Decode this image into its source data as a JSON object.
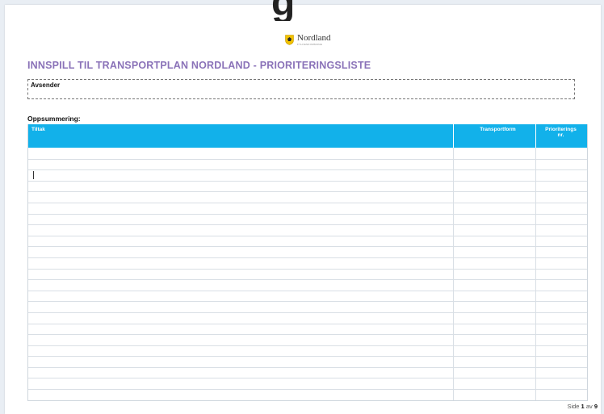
{
  "logo": {
    "name": "Nordland",
    "subtitle": "FYLKESKOMMUNE",
    "top_glyph": "g"
  },
  "document": {
    "title": "INNSPILL TIL TRANSPORTPLAN NORDLAND - PRIORITERINGSLISTE",
    "sender_label": "Avsender",
    "summary_label": "Oppsummering:"
  },
  "table": {
    "headers": {
      "tiltak": "Tiltak",
      "transportform": "Transportform",
      "prioritering_line1": "Prioriterings",
      "prioritering_line2": "nr."
    },
    "row_count": 23,
    "caret_row": 2
  },
  "footer": {
    "prefix": "Side",
    "page": "1",
    "separator": "av",
    "total": "9"
  },
  "colors": {
    "header_bg": "#12b1ea",
    "title": "#8a72b8"
  }
}
